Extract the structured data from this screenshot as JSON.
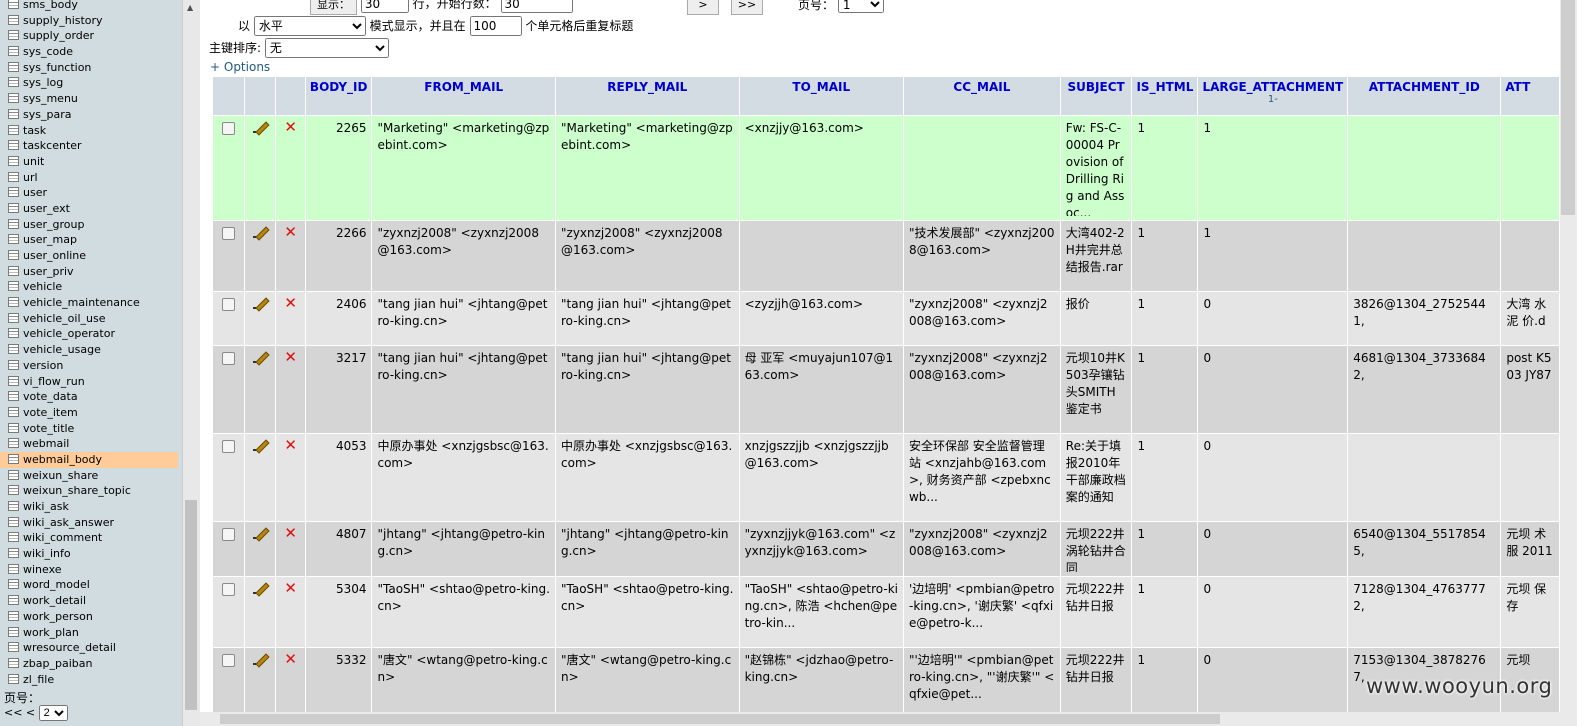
{
  "sidebar": {
    "tables": [
      "sms_body",
      "supply_history",
      "supply_order",
      "sys_code",
      "sys_function",
      "sys_log",
      "sys_menu",
      "sys_para",
      "task",
      "taskcenter",
      "unit",
      "url",
      "user",
      "user_ext",
      "user_group",
      "user_map",
      "user_online",
      "user_priv",
      "vehicle",
      "vehicle_maintenance",
      "vehicle_oil_use",
      "vehicle_operator",
      "vehicle_usage",
      "version",
      "vi_flow_run",
      "vote_data",
      "vote_item",
      "vote_title",
      "webmail",
      "webmail_body",
      "weixun_share",
      "weixun_share_topic",
      "wiki_ask",
      "wiki_ask_answer",
      "wiki_comment",
      "wiki_info",
      "winexe",
      "word_model",
      "work_detail",
      "work_person",
      "work_plan",
      "wresource_detail",
      "zbap_paiban",
      "zl_file"
    ],
    "active": "webmail_body",
    "page_label": "页号：",
    "page_nav": "<< <",
    "page_value": "2"
  },
  "controls": {
    "show_label": "显示：",
    "rows_value": "30",
    "rows_label": "行，开始行数：",
    "start_value": "30",
    "next_btn": ">",
    "last_btn": ">>",
    "page_label": "页号：",
    "page_value": "1",
    "mode_prefix": "以",
    "mode_value": "水平",
    "mode_suffix": "模式显示，并且在",
    "repeat_value": "100",
    "repeat_suffix": "个单元格后重复标题",
    "sort_label": "主键排序:",
    "sort_value": "无",
    "options_link": "+ Options"
  },
  "table": {
    "columns": [
      "BODY_ID",
      "FROM_MAIL",
      "REPLY_MAIL",
      "TO_MAIL",
      "CC_MAIL",
      "SUBJECT",
      "IS_HTML",
      "LARGE_ATTACHMENT",
      "ATTACHMENT_ID",
      "ATT"
    ],
    "large_attachment_sub": "1-",
    "rows": [
      {
        "body_id": "2265",
        "from": "\"Marketing\" <marketing@zpebint.com>",
        "reply": "\"Marketing\" <marketing@zpebint.com>",
        "to": "<xnzjjy@163.com>",
        "cc": "",
        "subject": "Fw: FS-C-00004 Provision of Drilling Rig and Assoc...",
        "is_html": "1",
        "large": "1",
        "att_id": "",
        "att": ""
      },
      {
        "body_id": "2266",
        "from": "\"zyxnzj2008\" <zyxnzj2008@163.com>",
        "reply": "\"zyxnzj2008\" <zyxnzj2008@163.com>",
        "to": "",
        "cc": "\"技术发展部\" <zyxnzj2008@163.com>",
        "subject": "大湾402-2H井完井总结报告.rar",
        "is_html": "1",
        "large": "1",
        "att_id": "",
        "att": ""
      },
      {
        "body_id": "2406",
        "from": "\"tang jian hui\" <jhtang@petro-king.cn>",
        "reply": "\"tang jian hui\" <jhtang@petro-king.cn>",
        "to": "<zyzjjh@163.com>",
        "cc": "\"zyxnzj2008\" <zyxnzj2008@163.com>",
        "subject": "报价",
        "is_html": "1",
        "large": "0",
        "att_id": "3826@1304_27525441,",
        "att": "大湾 水泥 价.d"
      },
      {
        "body_id": "3217",
        "from": "\"tang jian hui\" <jhtang@petro-king.cn>",
        "reply": "\"tang jian hui\" <jhtang@petro-king.cn>",
        "to": "母 亚军 <muyajun107@163.com>",
        "cc": "\"zyxnzj2008\" <zyxnzj2008@163.com>",
        "subject": "元坝10井K503孕镶钻头SMITH鉴定书",
        "is_html": "1",
        "large": "0",
        "att_id": "4681@1304_37336842,",
        "att": "post K503 JY87"
      },
      {
        "body_id": "4053",
        "from": "中原办事处 <xnzjgsbsc@163.com>",
        "reply": "中原办事处 <xnzjgsbsc@163.com>",
        "to": "xnzjgszzjjb <xnzjgszzjjb@163.com>",
        "cc": "安全环保部 安全监督管理站 <xnzjahb@163.com>, 财务资产部 <zpebxncwb...",
        "subject": "Re:关于填报2010年干部廉政档案的通知",
        "is_html": "1",
        "large": "0",
        "att_id": "",
        "att": ""
      },
      {
        "body_id": "4807",
        "from": "\"jhtang\" <jhtang@petro-king.cn>",
        "reply": "\"jhtang\" <jhtang@petro-king.cn>",
        "to": "\"zyxnzjjyk@163.com\" <zyxnzjjyk@163.com>",
        "cc": "\"zyxnzj2008\" <zyxnzj2008@163.com>",
        "subject": "元坝222井涡轮钻井合同",
        "is_html": "1",
        "large": "0",
        "att_id": "6540@1304_55178545,",
        "att": "元坝 术服 2011"
      },
      {
        "body_id": "5304",
        "from": "\"TaoSH\" <shtao@petro-king.cn>",
        "reply": "\"TaoSH\" <shtao@petro-king.cn>",
        "to": "\"TaoSH\" <shtao@petro-king.cn>, 陈浩 <hchen@petro-kin...",
        "cc": "'边培明' <pmbian@petro-king.cn>, '谢庆繁' <qfxie@petro-k...",
        "subject": "元坝222井钻井日报",
        "is_html": "1",
        "large": "0",
        "att_id": "7128@1304_47637772,",
        "att": "元坝 保存"
      },
      {
        "body_id": "5332",
        "from": "\"唐文\" <wtang@petro-king.cn>",
        "reply": "\"唐文\" <wtang@petro-king.cn>",
        "to": "\"赵锦栋\" <jdzhao@petro-king.cn>",
        "cc": "\"'边培明'\" <pmbian@petro-king.cn>, \"'谢庆繁'\" <qfxie@pet...",
        "subject": "元坝222井钻井日报",
        "is_html": "1",
        "large": "0",
        "att_id": "7153@1304_38782767,",
        "att": "元坝"
      }
    ]
  },
  "watermark": "www.wooyun.org"
}
